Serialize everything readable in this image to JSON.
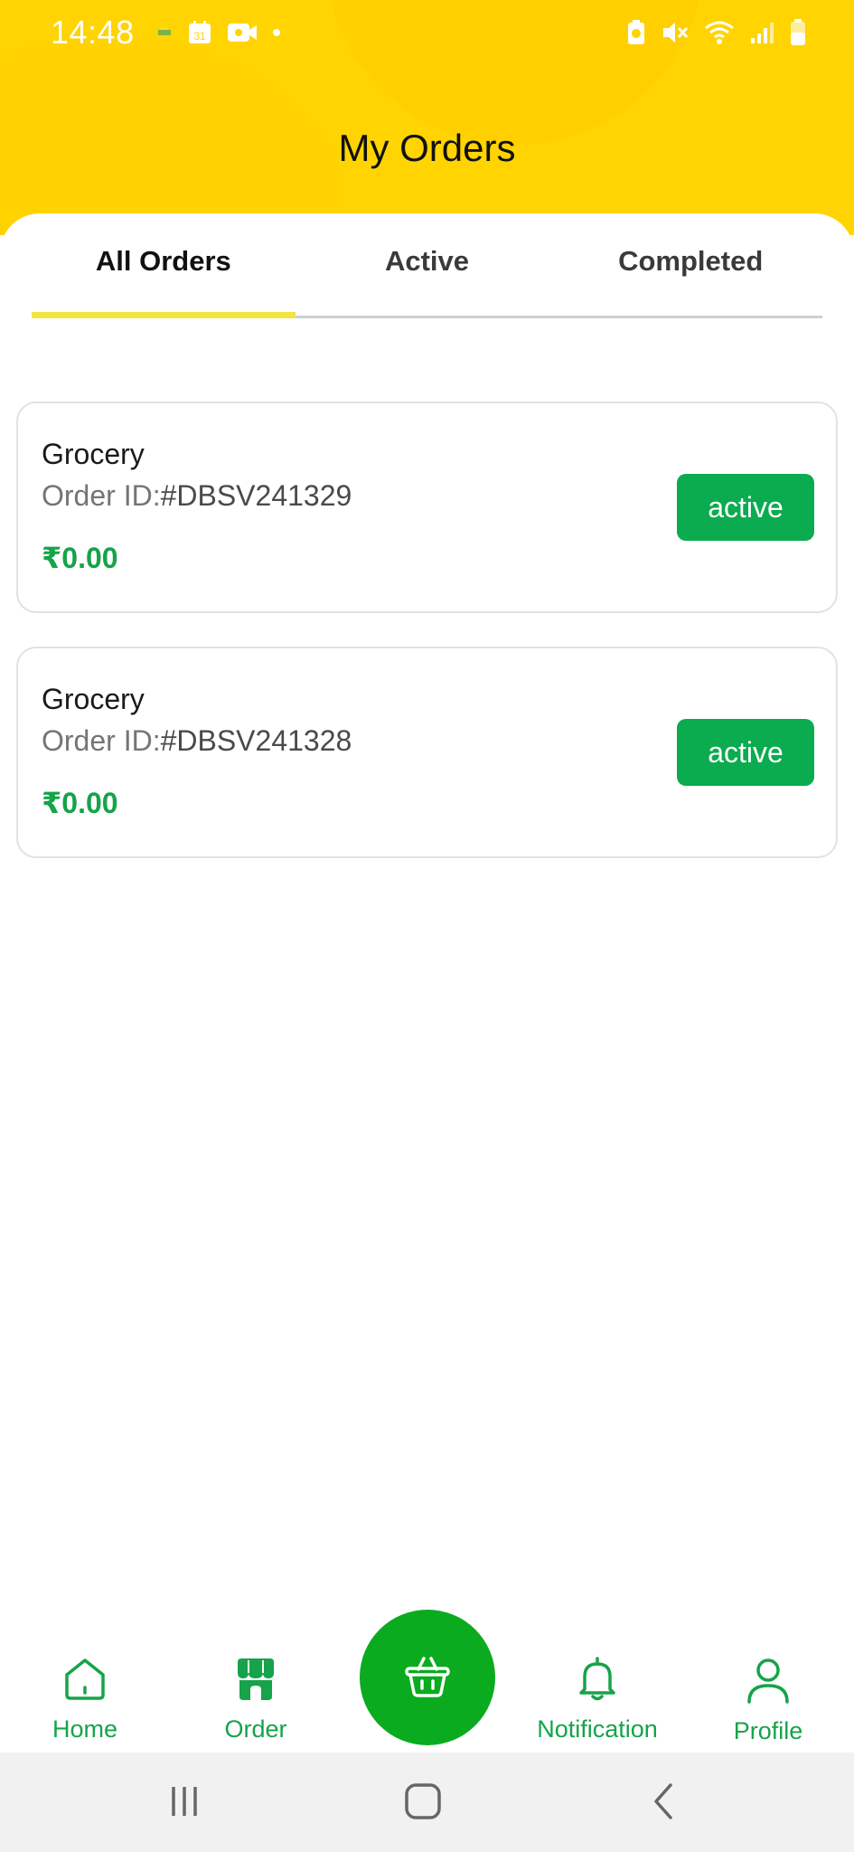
{
  "status_bar": {
    "time": "14:48",
    "calendar_day": "31"
  },
  "header": {
    "title": "My Orders",
    "background_color": "#ffd400"
  },
  "tabs": [
    {
      "label": "All Orders",
      "selected": true
    },
    {
      "label": "Active",
      "selected": false
    },
    {
      "label": "Completed",
      "selected": false
    }
  ],
  "orders": [
    {
      "name": "Grocery",
      "id_label": "Order ID:",
      "id_value": "#DBSV241329",
      "price": "₹0.00",
      "status": "active"
    },
    {
      "name": "Grocery",
      "id_label": "Order ID:",
      "id_value": "#DBSV241328",
      "price": "₹0.00",
      "status": "active"
    }
  ],
  "bottom_nav": {
    "home": {
      "label": "Home",
      "icon": "home-icon"
    },
    "order": {
      "label": "Order",
      "icon": "store-icon"
    },
    "cart": {
      "icon": "basket-icon"
    },
    "notification": {
      "label": "Notification",
      "icon": "bell-icon"
    },
    "profile": {
      "label": "Profile",
      "icon": "user-icon"
    }
  },
  "colors": {
    "accent_green": "#16a34a",
    "badge_green": "#0bab4f",
    "fab_green": "#0aab1f",
    "tab_indicator": "#f5e342"
  }
}
